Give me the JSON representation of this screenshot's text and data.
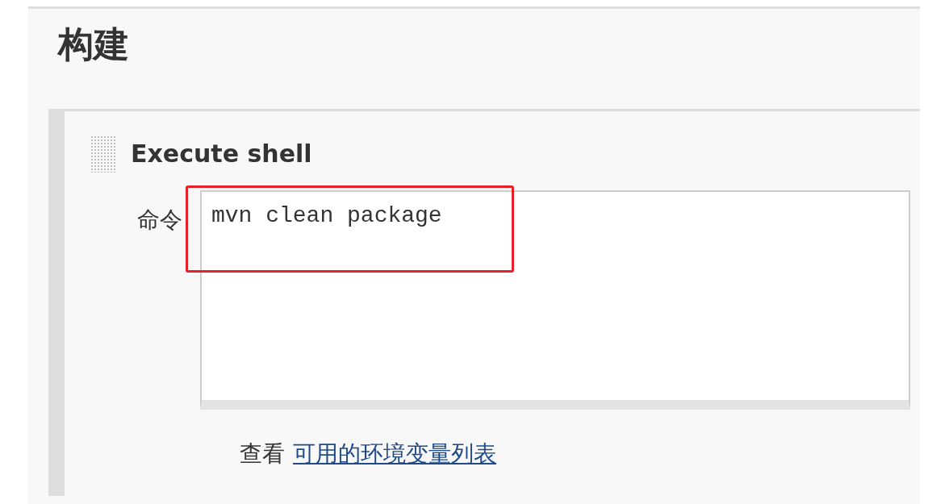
{
  "section": {
    "title": "构建"
  },
  "build_step": {
    "title": "Execute shell",
    "command_label": "命令",
    "command_value": "mvn clean package",
    "help_prefix": "查看",
    "help_link": "可用的环境变量列表"
  },
  "annotation": {
    "kind": "highlight"
  }
}
